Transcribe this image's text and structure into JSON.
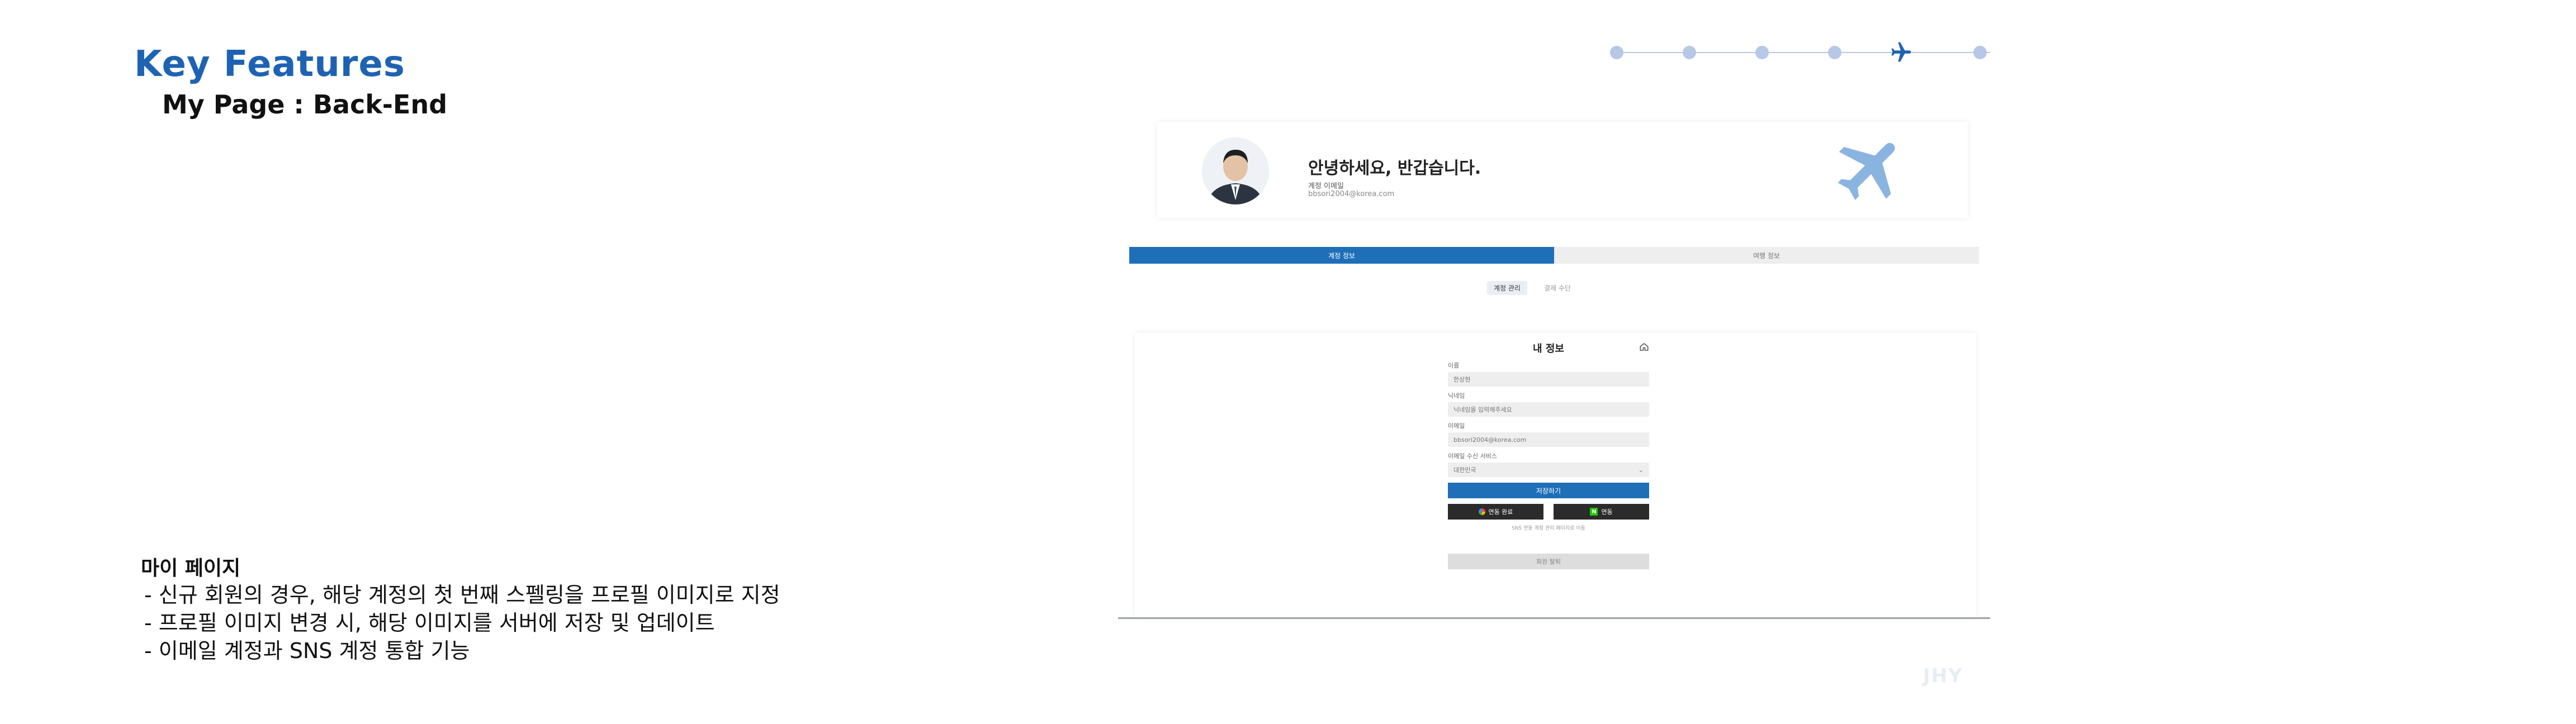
{
  "header": {
    "title": "Key Features",
    "subtitle": "My Page : Back-End"
  },
  "description": {
    "section_title": "마이 페이지",
    "bullets": [
      "- 신규 회원의 경우, 해당 계정의 첫 번째 스펠링을 프로필 이미지로 지정",
      "- 프로필 이미지 변경 시, 해당 이미지를 서버에 저장 및 업데이트",
      "- 이메일 계정과 SNS 계정 통합 기능"
    ]
  },
  "progress": {
    "total_steps": 6,
    "current_step": 5,
    "color": "#b7c8e6",
    "current_color": "#1e63b3"
  },
  "screenshot": {
    "greeting": "안녕하세요, 반갑습니다.",
    "account_label": "계정 이메일",
    "account_email": "bbsori2004@korea.com",
    "tabs": [
      "계정 정보",
      "여행 정보"
    ],
    "subtabs": [
      "계정 관리",
      "결제 수단"
    ],
    "form": {
      "title": "내 정보",
      "name_label": "이름",
      "name_value": "한상현",
      "nickname_label": "닉네임",
      "nickname_placeholder": "닉네임을 입력해주세요",
      "email_label": "이메일",
      "email_value": "bbsori2004@korea.com",
      "email_receive_label": "이메일 수신 서비스",
      "email_receive_value": "대한민국",
      "save_label": "저장하기",
      "google_label": "연동 완료",
      "naver_label": "연동",
      "note": "SNS 연동 계정 관리 페이지로 이동",
      "delete_label": "회원 탈퇴"
    }
  },
  "watermark": "JHY",
  "colors": {
    "accent": "#1e63b3",
    "primary_button": "#1f6fb8",
    "plane": "#8ab4e0"
  }
}
